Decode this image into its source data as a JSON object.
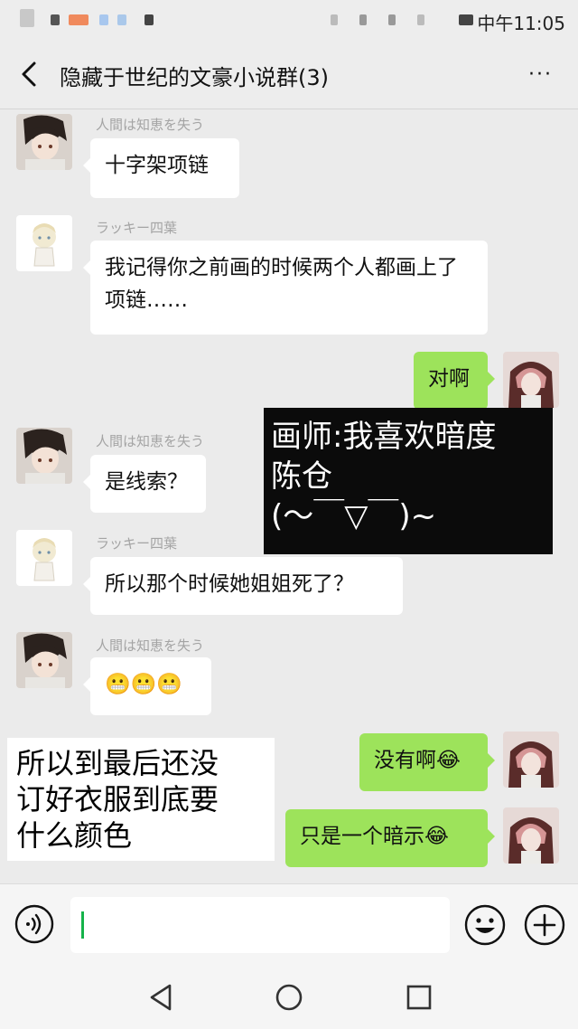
{
  "status_bar": {
    "time": "中午11:05"
  },
  "header": {
    "title": "隐藏于世纪的文豪小说群(3)",
    "more": "···"
  },
  "messages": [
    {
      "sender": "人間は知恵を失う",
      "text": "十字架项链"
    },
    {
      "sender": "ラッキー四葉",
      "text": "我记得你之前画的时候两个人都画上了项链……"
    },
    {
      "text": "对啊"
    },
    {
      "sender": "人間は知恵を失う",
      "text": "是线索？"
    },
    {
      "sender": "ラッキー四葉",
      "text": "所以那个时候她姐姐死了？"
    },
    {
      "sender": "人間は知恵を失う",
      "text": "😬😬😬"
    },
    {
      "text": "没有啊😂"
    },
    {
      "text": "只是一个暗示😂"
    }
  ],
  "overlays": {
    "black_caption": {
      "line1": "画师:我喜欢暗度",
      "line2": "陈仓",
      "line3": "(～￣▽￣)~"
    },
    "white_caption": {
      "line1": "所以到最后还没",
      "line2": "订好衣服到底要",
      "line3": "什么颜色"
    }
  },
  "colors": {
    "outgoing_bubble": "#9de35b",
    "incoming_bubble": "#ffffff",
    "chat_background": "#ebebeb",
    "cursor": "#15b34a"
  },
  "icons": {
    "voice": "voice-icon",
    "emoji": "emoji-icon",
    "plus": "plus-icon",
    "back": "back-arrow-icon"
  }
}
